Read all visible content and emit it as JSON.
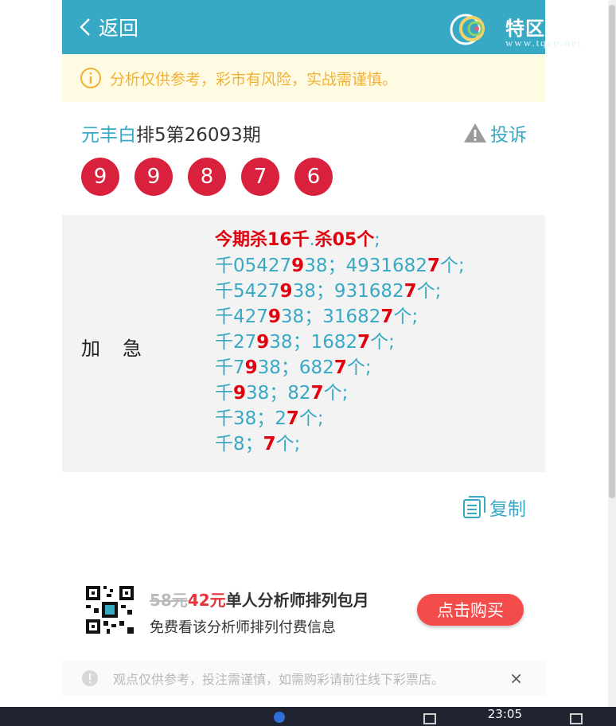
{
  "header": {
    "back_label": "返回",
    "brand_name": "特区彩票网",
    "brand_url": "www.tqcp.net"
  },
  "notice": {
    "text": "分析仅供参考，彩市有风险，实战需谨慎。"
  },
  "title": {
    "analyst": "元丰白",
    "issue": "排5第26093期",
    "report_label": "投诉"
  },
  "balls": [
    "9",
    "9",
    "8",
    "7",
    "6"
  ],
  "content": {
    "label": "加急",
    "head": {
      "a": "今期杀16千",
      "dot": ".",
      "b": "杀05个",
      "c": ";"
    },
    "lines": [
      {
        "a": "千05427",
        "b": "9",
        "c": "38；4931682",
        "d": "7",
        "e": "个;"
      },
      {
        "a": "千5427",
        "b": "9",
        "c": "38；931682",
        "d": "7",
        "e": "个;"
      },
      {
        "a": "千427",
        "b": "9",
        "c": "38；31682",
        "d": "7",
        "e": "个;"
      },
      {
        "a": "千27",
        "b": "9",
        "c": "38；1682",
        "d": "7",
        "e": "个;"
      },
      {
        "a": "千7",
        "b": "9",
        "c": "38；682",
        "d": "7",
        "e": "个;"
      },
      {
        "a": "千",
        "b": "9",
        "c": "38；82",
        "d": "7",
        "e": "个;"
      },
      {
        "a": "千38；2",
        "b": "7",
        "c": "个;",
        "d": "",
        "e": ""
      },
      {
        "a": "千8；",
        "b": "7",
        "c": "个;",
        "d": "",
        "e": ""
      }
    ]
  },
  "copy_label": "复制",
  "promo": {
    "old_price": "58元",
    "new_price": "42元",
    "title": "单人分析师排列包月",
    "subtitle": "免费看该分析师排列付费信息",
    "buy_label": "点击购买"
  },
  "foot_note": {
    "text": "观点仅供参考，投注需谨慎，如需购彩请前往线下彩票店。",
    "close": "×"
  },
  "taskbar": {
    "time": "23:05"
  },
  "colors": {
    "header_bg": "#38a9c5",
    "accent": "#38a9c5",
    "ball": "#d9203c",
    "highlight": "#e0000e",
    "notice_text": "#f0b236",
    "buy_button": "#f44b4b"
  }
}
